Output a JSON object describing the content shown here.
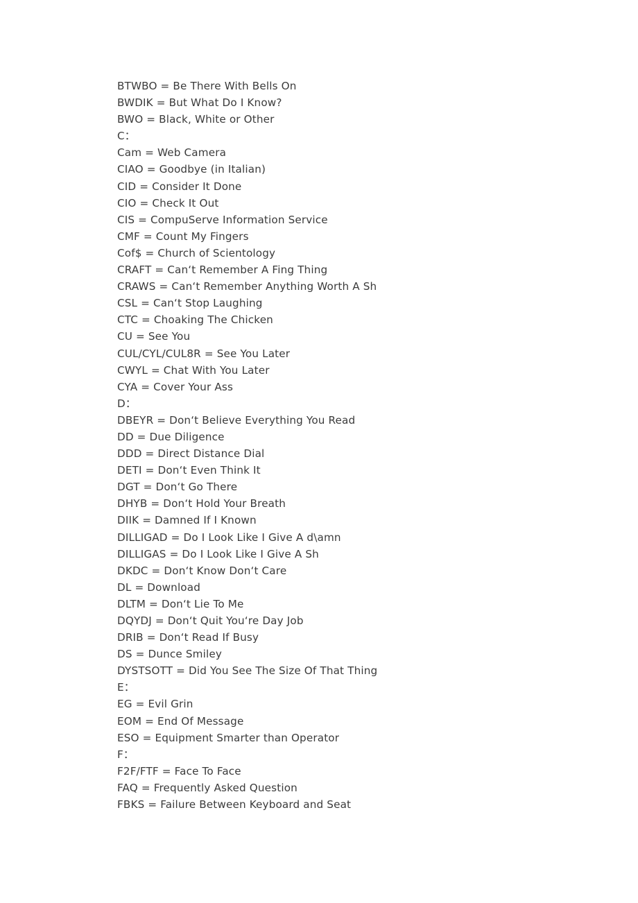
{
  "document": {
    "type": "text-page",
    "background_color": "#ffffff",
    "text_color": "#3b3b3b",
    "lines": [
      {
        "text": "BTWBO = Be There With Bells On",
        "kind": "entry"
      },
      {
        "text": "BWDIK = But What Do I Know?",
        "kind": "entry"
      },
      {
        "text": "BWO = Black, White or Other",
        "kind": "entry"
      },
      {
        "text": "C：",
        "kind": "section"
      },
      {
        "text": "Cam = Web Camera",
        "kind": "entry"
      },
      {
        "text": "CIAO = Goodbye (in Italian)",
        "kind": "entry"
      },
      {
        "text": "CID = Consider It Done",
        "kind": "entry"
      },
      {
        "text": "CIO = Check It Out",
        "kind": "entry"
      },
      {
        "text": "CIS = CompuServe Information Service",
        "kind": "entry"
      },
      {
        "text": "CMF = Count My Fingers",
        "kind": "entry"
      },
      {
        "text": "Cof$ = Church of Scientology",
        "kind": "entry"
      },
      {
        "text": "CRAFT = Can‘t Remember A Fing Thing",
        "kind": "entry"
      },
      {
        "text": "CRAWS = Can‘t Remember Anything Worth A Sh",
        "kind": "entry"
      },
      {
        "text": "CSL = Can‘t Stop Laughing",
        "kind": "entry"
      },
      {
        "text": "CTC = Choaking The Chicken",
        "kind": "entry"
      },
      {
        "text": "CU = See You",
        "kind": "entry"
      },
      {
        "text": "CUL/CYL/CUL8R = See You Later",
        "kind": "entry"
      },
      {
        "text": "CWYL = Chat With You Later",
        "kind": "entry"
      },
      {
        "text": "CYA = Cover Your Ass",
        "kind": "entry"
      },
      {
        "text": "D：",
        "kind": "section"
      },
      {
        "text": "DBEYR = Don‘t Believe Everything You Read",
        "kind": "entry"
      },
      {
        "text": "DD = Due Diligence",
        "kind": "entry"
      },
      {
        "text": "DDD = Direct Distance Dial",
        "kind": "entry"
      },
      {
        "text": "DETI = Don‘t Even Think It",
        "kind": "entry"
      },
      {
        "text": "DGT = Don‘t Go There",
        "kind": "entry"
      },
      {
        "text": "DHYB = Don‘t Hold Your Breath",
        "kind": "entry"
      },
      {
        "text": "DIIK = Damned If I Known",
        "kind": "entry"
      },
      {
        "text": "DILLIGAD = Do I Look Like I Give A d\\amn",
        "kind": "entry"
      },
      {
        "text": "DILLIGAS = Do I Look Like I Give A Sh",
        "kind": "entry"
      },
      {
        "text": "DKDC = Don‘t Know Don‘t Care",
        "kind": "entry"
      },
      {
        "text": "DL = Download",
        "kind": "entry"
      },
      {
        "text": "DLTM = Don‘t Lie To Me",
        "kind": "entry"
      },
      {
        "text": "DQYDJ = Don‘t Quit You‘re Day Job",
        "kind": "entry"
      },
      {
        "text": "DRIB = Don‘t Read If Busy",
        "kind": "entry"
      },
      {
        "text": "DS = Dunce Smiley",
        "kind": "entry"
      },
      {
        "text": "DYSTSOTT = Did You See The Size Of That Thing",
        "kind": "entry"
      },
      {
        "text": "E：",
        "kind": "section"
      },
      {
        "text": "EG = Evil Grin",
        "kind": "entry"
      },
      {
        "text": "EOM = End Of Message",
        "kind": "entry"
      },
      {
        "text": "ESO = Equipment Smarter than Operator",
        "kind": "entry"
      },
      {
        "text": "F：",
        "kind": "section"
      },
      {
        "text": "F2F/FTF = Face To Face",
        "kind": "entry"
      },
      {
        "text": "FAQ = Frequently Asked Question",
        "kind": "entry"
      },
      {
        "text": "FBKS = Failure Between Keyboard and Seat",
        "kind": "entry"
      }
    ]
  }
}
